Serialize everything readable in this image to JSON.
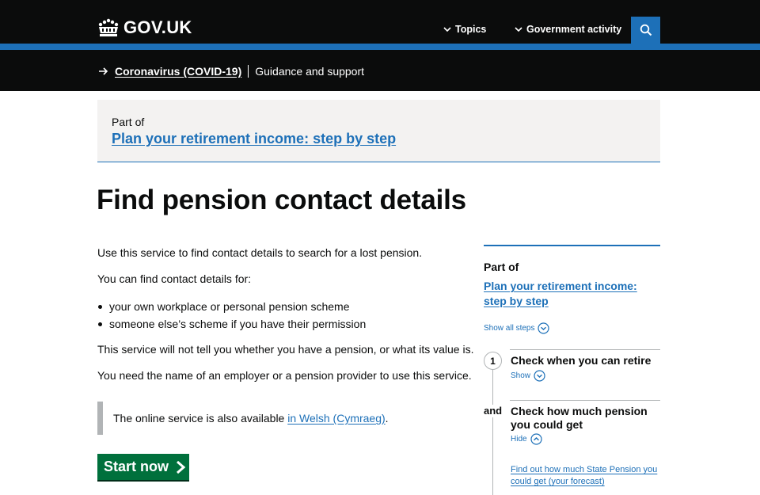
{
  "header": {
    "logo_text": "GOV.UK",
    "nav": [
      {
        "label": "Topics",
        "icon": "chevron-down-icon"
      },
      {
        "label": "Government activity",
        "icon": "chevron-down-icon"
      }
    ],
    "search_icon": "search-icon"
  },
  "banner": {
    "link": "Coronavirus (COVID-19)",
    "text": "Guidance and support"
  },
  "part_of_box": {
    "label": "Part of",
    "link": "Plan your retirement income: step by step"
  },
  "page_title": "Find pension contact details",
  "body": {
    "intro": "Use this service to find contact details to search for a lost pension.",
    "can_find": "You can find contact details for:",
    "bullets": [
      "your own workplace or personal pension scheme",
      "someone else’s scheme if you have their permission"
    ],
    "not_tell": "This service will not tell you whether you have a pension, or what its value is.",
    "need_name": "You need the name of an employer or a pension provider to use this service."
  },
  "inset": {
    "text_before": "The online service is also available ",
    "link": "in Welsh (Cymraeg)",
    "text_after": "."
  },
  "start_button": "Start now",
  "sidebar": {
    "part_of": "Part of",
    "link": "Plan your retirement income: step by step",
    "show_all": "Show all steps",
    "steps": [
      {
        "marker": "1",
        "title": "Check when you can retire",
        "toggle": "Show"
      },
      {
        "marker": "and",
        "title": "Check how much pension you could get",
        "toggle": "Hide",
        "sublink": "Find out how much State Pension you could get (your forecast)"
      }
    ]
  },
  "colors": {
    "header_bg": "#0b0c0c",
    "brand_blue": "#1d70b8",
    "start_green": "#00703c",
    "panel_grey": "#f3f2f1",
    "border_grey": "#b1b4b6"
  }
}
